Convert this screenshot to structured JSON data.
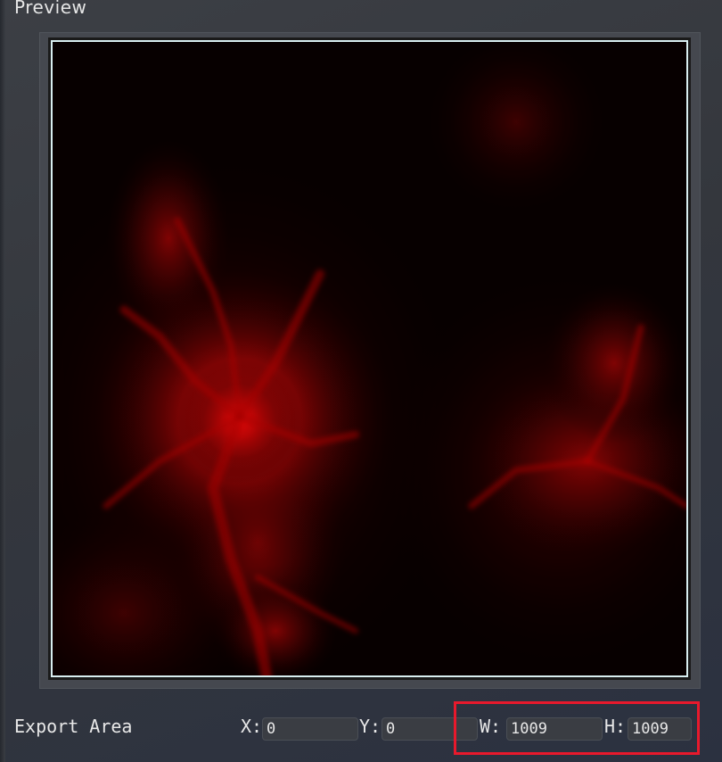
{
  "panel": {
    "title": "Preview"
  },
  "preview": {
    "description_icon": "heightmap-preview",
    "tint_color": "#ff0000"
  },
  "export_area": {
    "label": "Export Area",
    "x_label": "X:",
    "x_value": "0",
    "y_label": "Y:",
    "y_value": "0",
    "w_label": "W:",
    "w_value": "1009",
    "h_label": "H:",
    "h_value": "1009"
  },
  "colors": {
    "highlight": "#e8192c",
    "accent_border": "#d8eef0"
  }
}
